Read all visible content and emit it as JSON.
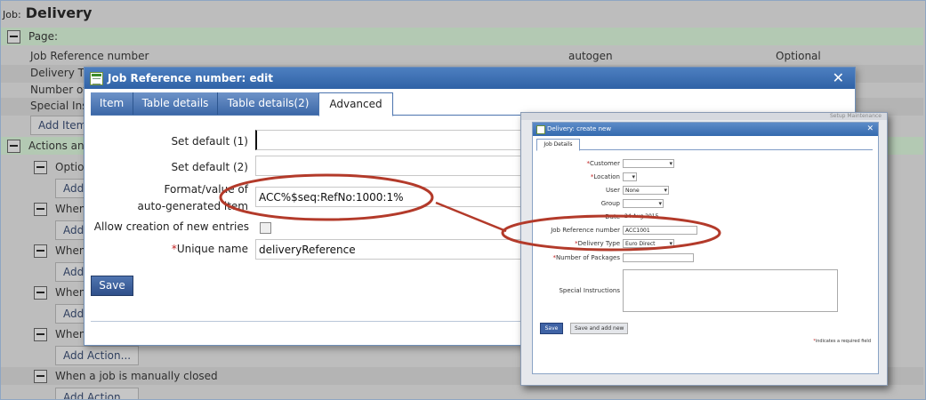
{
  "page": {
    "job_label": "Job:",
    "job_name": "Delivery",
    "section_page": "Page:",
    "rows": [
      {
        "name": "Job Reference number",
        "value": "autogen",
        "status": "Optional"
      },
      {
        "name": "Delivery T"
      },
      {
        "name": "Number of"
      },
      {
        "name": "Special Ins"
      }
    ],
    "add_item_label": "Add Item",
    "section_actions": "Actions and",
    "action_rows": [
      {
        "label": "Optio",
        "add": "Add"
      },
      {
        "label": "When",
        "add": "Add"
      },
      {
        "label": "When",
        "add": "Add"
      },
      {
        "label": "When",
        "add": "Add"
      },
      {
        "label": "When",
        "add": "Add Action..."
      },
      {
        "label": "When a job is manually closed",
        "add": "Add Action..."
      }
    ]
  },
  "dialog": {
    "title": "Job Reference number: edit",
    "close": "✕",
    "tabs": [
      "Item",
      "Table details",
      "Table details(2)",
      "Advanced"
    ],
    "active_tab": "Advanced",
    "fields": {
      "default1_label": "Set default (1)",
      "default2_label": "Set default (2)",
      "format_label_line1": "Format/value of",
      "format_label_line2": "auto-generated item",
      "format_value": "ACC%$seq:RefNo:1000:1%",
      "allow_label": "Allow creation of new entries",
      "unique_label": "Unique name",
      "unique_value": "deliveryReference"
    },
    "save_label": "Save"
  },
  "inset": {
    "top_text": "Setup Maintenance",
    "title": "Delivery: create new",
    "close": "✕",
    "tab": "Job Details",
    "labels": {
      "customer": "Customer",
      "location": "Location",
      "user": "User",
      "group": "Group",
      "date": "Date",
      "job_ref": "Job Reference number",
      "delivery_type": "Delivery Type",
      "packages": "Number of Packages",
      "instructions": "Special Instructions"
    },
    "values": {
      "user": "None",
      "date": "24 Aug 2015",
      "job_ref": "ACC1001",
      "delivery_type": "Euro Direct"
    },
    "save": "Save",
    "save_new": "Save and add new",
    "required_note": "indicates a required field"
  },
  "colors": {
    "annotation": "#b33a2a",
    "title_bar": "#3a6cb0",
    "section_bg": "#b3c9b3"
  }
}
